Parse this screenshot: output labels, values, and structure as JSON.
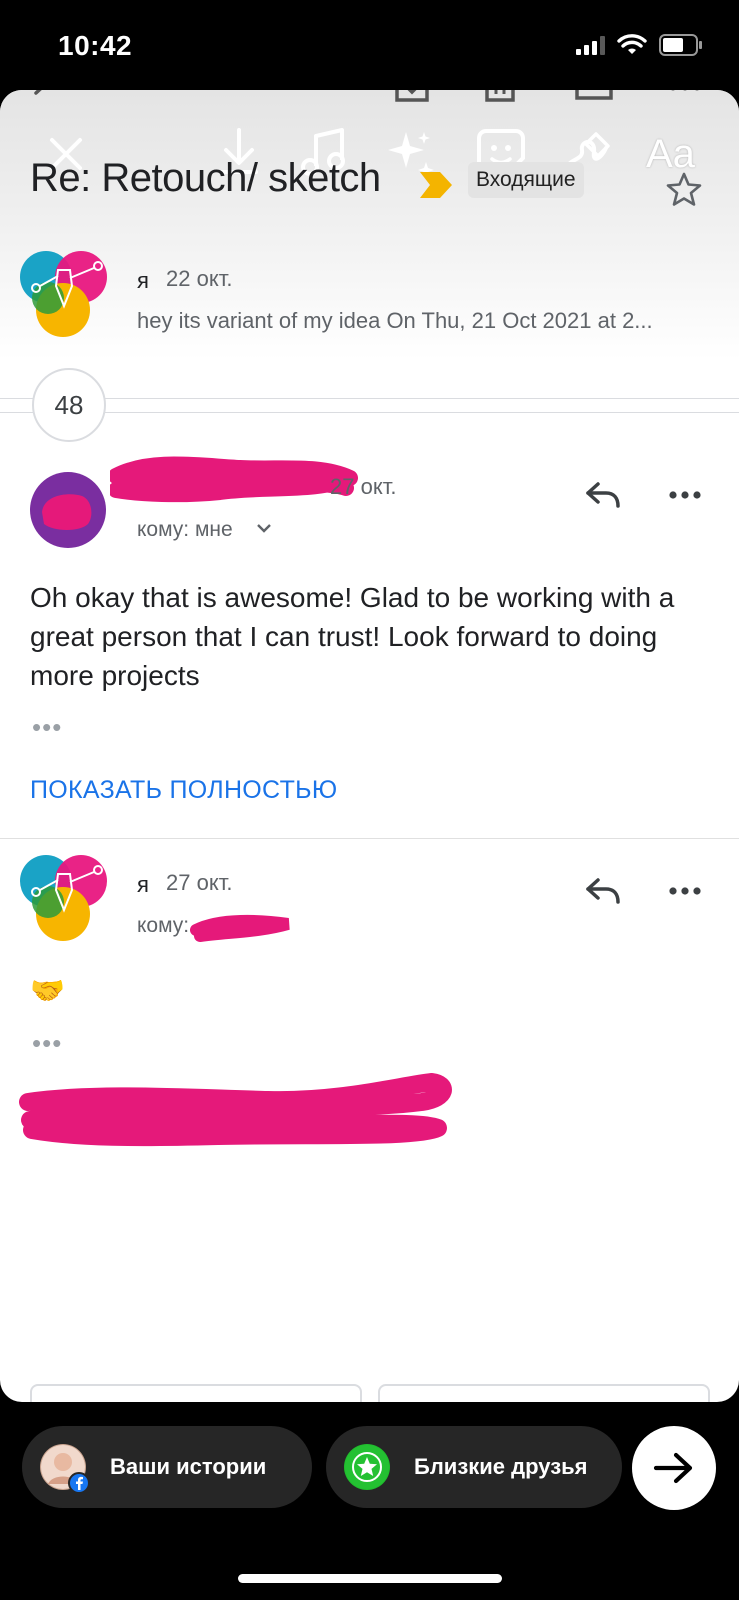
{
  "status_bar": {
    "time": "10:42"
  },
  "story_tools": {
    "close_icon": "close-icon",
    "download_icon": "download-icon",
    "music_icon": "music-icon",
    "effects_icon": "sparkles-icon",
    "sticker_icon": "sticker-icon",
    "draw_icon": "draw-icon",
    "text_label": "Aa"
  },
  "email": {
    "subject": "Re: Retouch/ sketch",
    "label": "Входящие",
    "collapsed_count": "48",
    "messages": [
      {
        "sender": "я",
        "date": "22 окт.",
        "snippet": "hey its variant of my idea On Thu, 21 Oct 2021 at 2..."
      },
      {
        "date": "27 окт.",
        "to": "кому: мне",
        "body": "Oh okay that is awesome! Glad to be working with a great person that I can trust! Look forward to doing more projects",
        "ellipsis": "•••",
        "show_full": "ПОКАЗАТЬ ПОЛНОСТЬЮ"
      },
      {
        "sender": "я",
        "date": "27 окт.",
        "to": "кому:",
        "body": "🤝",
        "ellipsis": "•••"
      }
    ]
  },
  "share_bar": {
    "your_story": "Ваши истории",
    "close_friends": "Близкие друзья"
  },
  "colors": {
    "scribble": "#e5197a",
    "link": "#1a73e8",
    "important": "#f4b400",
    "avatar_purple": "#7a2ea0"
  }
}
